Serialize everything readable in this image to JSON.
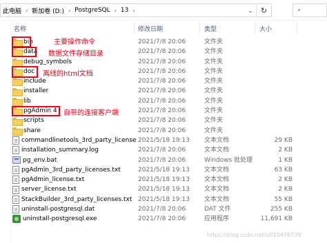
{
  "breadcrumb": {
    "items": [
      "此电脑",
      "新加卷 (D:)",
      "PostgreSQL",
      "13"
    ],
    "separator": "›"
  },
  "columns": {
    "name": "名称",
    "date": "修改日期",
    "type": "类型",
    "size": "大小"
  },
  "files": [
    {
      "name": "bin",
      "date": "2021/7/8 20:06",
      "type": "文件夹",
      "size": "",
      "icon": "folder-icon"
    },
    {
      "name": "data",
      "date": "2021/7/8 20:06",
      "type": "文件夹",
      "size": "",
      "icon": "folder-icon"
    },
    {
      "name": "debug_symbols",
      "date": "2021/7/8 20:06",
      "type": "文件夹",
      "size": "",
      "icon": "folder-icon"
    },
    {
      "name": "doc",
      "date": "2021/7/8 20:06",
      "type": "文件夹",
      "size": "",
      "icon": "folder-icon"
    },
    {
      "name": "include",
      "date": "2021/7/8 20:06",
      "type": "文件夹",
      "size": "",
      "icon": "folder-icon"
    },
    {
      "name": "installer",
      "date": "2021/7/8 20:06",
      "type": "文件夹",
      "size": "",
      "icon": "folder-icon"
    },
    {
      "name": "lib",
      "date": "2021/7/8 20:06",
      "type": "文件夹",
      "size": "",
      "icon": "folder-icon"
    },
    {
      "name": "pgAdmin 4",
      "date": "2021/7/8 20:06",
      "type": "文件夹",
      "size": "",
      "icon": "folder-icon"
    },
    {
      "name": "scripts",
      "date": "2021/7/8 20:06",
      "type": "文件夹",
      "size": "",
      "icon": "folder-icon"
    },
    {
      "name": "share",
      "date": "2021/7/8 20:06",
      "type": "文件夹",
      "size": "",
      "icon": "folder-icon"
    },
    {
      "name": "commandlinetools_3rd_party_licenses...",
      "date": "2021/5/18 19:13",
      "type": "文本文档",
      "size": "29 KB",
      "icon": "text-file-icon"
    },
    {
      "name": "installation_summary.log",
      "date": "2021/7/8 20:06",
      "type": "文本文档",
      "size": "2 KB",
      "icon": "text-file-icon"
    },
    {
      "name": "pg_env.bat",
      "date": "2021/7/8 20:06",
      "type": "Windows 批处理...",
      "size": "1 KB",
      "icon": "batch-file-icon"
    },
    {
      "name": "pgAdmin_3rd_party_licenses.txt",
      "date": "2021/5/18 19:13",
      "type": "文本文档",
      "size": "63 KB",
      "icon": "text-file-icon"
    },
    {
      "name": "pgAdmin_license.txt",
      "date": "2021/5/18 19:13",
      "type": "文本文档",
      "size": "2 KB",
      "icon": "text-file-icon"
    },
    {
      "name": "server_license.txt",
      "date": "2021/5/18 19:13",
      "type": "文本文档",
      "size": "2 KB",
      "icon": "text-file-icon"
    },
    {
      "name": "StackBuilder_3rd_party_licenses.txt",
      "date": "2021/5/18 19:13",
      "type": "文本文档",
      "size": "55 KB",
      "icon": "text-file-icon"
    },
    {
      "name": "uninstall-postgresql.dat",
      "date": "2021/7/8 20:06",
      "type": "DAT 文件",
      "size": "255 KB",
      "icon": "dat-file-icon"
    },
    {
      "name": "uninstall-postgresql.exe",
      "date": "2021/7/8 20:06",
      "type": "应用程序",
      "size": "11,691 KB",
      "icon": "exe-file-icon"
    }
  ],
  "annotations": {
    "bin": "主要操作命令",
    "data": "数据文件存储目录",
    "doc": "离线的html文档",
    "pgadmin": "自带的连接客户端"
  },
  "colors": {
    "annotation": "#e8001c",
    "folder": "#f4cf62",
    "header_text": "#4c607a"
  },
  "watermark": "https://blog.csdn.net/u010476739"
}
